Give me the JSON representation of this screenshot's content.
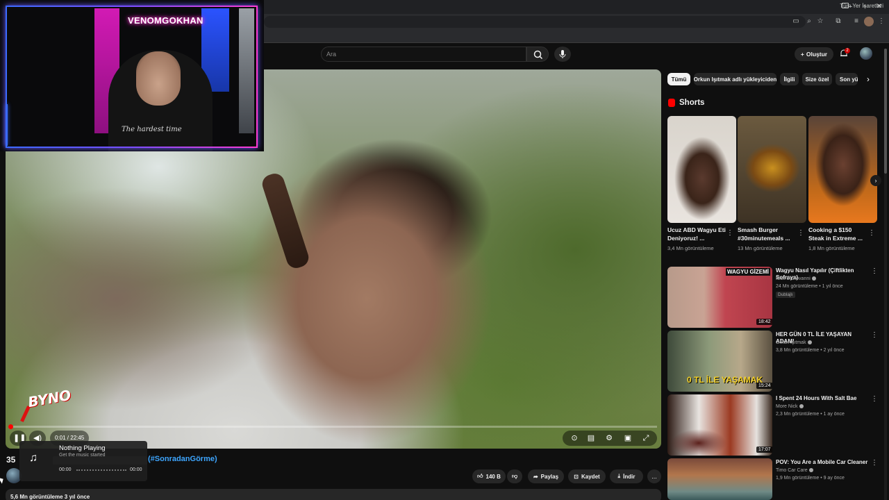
{
  "browser": {
    "bookmarks_label": "Tüm Yer İşaretleri",
    "window_icons": [
      "minimize-icon",
      "maximize-icon",
      "close-icon"
    ]
  },
  "header": {
    "search_placeholder": "Ara",
    "create_label": "Oluştur",
    "notifications_count": "2"
  },
  "player": {
    "time": "0:01 / 22:45",
    "progress_fraction": 0.002,
    "overlay_logo": "BYNO"
  },
  "webcam": {
    "neon_sign": "VENOMGOKHAN",
    "shirt_text": "The hardest time"
  },
  "video": {
    "title_prefix": "35",
    "title_hashtag": "(#SonradanGörme)",
    "likes": "140 B",
    "share_label": "Paylaş",
    "save_label": "Kaydet",
    "download_label": "İndir",
    "views_date": "5,6 Mn görüntüleme  3 yıl önce",
    "more_label": "..."
  },
  "now_playing": {
    "title": "Nothing Playing",
    "subtitle": "Get the music started",
    "time_start": "00:00",
    "time_end": "00:00"
  },
  "chips": [
    "Tümü",
    "Orkun Işıtmak adlı yükleyiciden",
    "İlgili",
    "Size özel",
    "Son yü"
  ],
  "shorts": {
    "title": "Shorts",
    "items": [
      {
        "title": "Ucuz ABD Wagyu Eti Deniyoruz! ...",
        "views": "3,4 Mn görüntüleme"
      },
      {
        "title": "Smash Burger #30minutemeals ...",
        "views": "13 Mn görüntüleme"
      },
      {
        "title": "Cooking a $150 Steak in Extreme ...",
        "views": "1,8 Mn görüntüleme"
      }
    ]
  },
  "recommendations": [
    {
      "title": "Wagyu Nasıl Yapılır (Çiftlikten Sofraya)",
      "channel": "Nick DiGiovanni",
      "meta": "24 Mn görüntüleme • 1 yıl önce",
      "badge": "Dublajlı",
      "duration": "18:42",
      "thumb_text": "WAGYU GİZEMİ"
    },
    {
      "title": "HER GÜN 0 TL İLE YAŞAYAN ADAM!",
      "channel": "Orkun Işıtmak",
      "meta": "3,8 Mn görüntüleme • 2 yıl önce",
      "badge": "",
      "duration": "15:24",
      "thumb_text": "0 TL İLE YAŞAMAK"
    },
    {
      "title": "I Spent 24 Hours With Salt Bae",
      "channel": "More Nick",
      "meta": "2,3 Mn görüntüleme • 1 ay önce",
      "badge": "",
      "duration": "17:07",
      "thumb_text": ""
    },
    {
      "title": "POV: You Are a Mobile Car Cleaner",
      "channel": "Timo Car Care",
      "meta": "1,9 Mn görüntüleme • 9 ay önce",
      "badge": "",
      "duration": "",
      "thumb_text": ""
    }
  ]
}
